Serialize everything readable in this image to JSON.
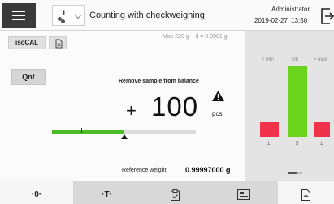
{
  "header": {
    "title": "Counting with checkweighing",
    "method_number": "1",
    "user": "Administrator",
    "date": "2019-02-27",
    "time": "13:50"
  },
  "tools": {
    "isocal_label": "isoCAL",
    "qnt_label": "Qnt"
  },
  "balance_info": "Max 220 g    d = 0.0001 g",
  "display": {
    "instruction": "Remove sample from balance",
    "sign": "+",
    "value": "100",
    "unit": "pcs",
    "weighing_progress": 0.5
  },
  "reference": {
    "label": "Reference weight",
    "value": "0.99997000 g"
  },
  "graph": {
    "labels": [
      "< min",
      "OK",
      "> max"
    ],
    "counts": [
      "1",
      "5",
      "1"
    ],
    "colors": {
      "under": "#f0324b",
      "ok": "#6cd31c",
      "over": "#f0324b"
    }
  },
  "toolbar": {
    "zero_label": "·0·",
    "tare_label": "·T·"
  },
  "colors": {
    "accent_green": "#4cbd24",
    "menu_dark": "#3a3a3a"
  }
}
